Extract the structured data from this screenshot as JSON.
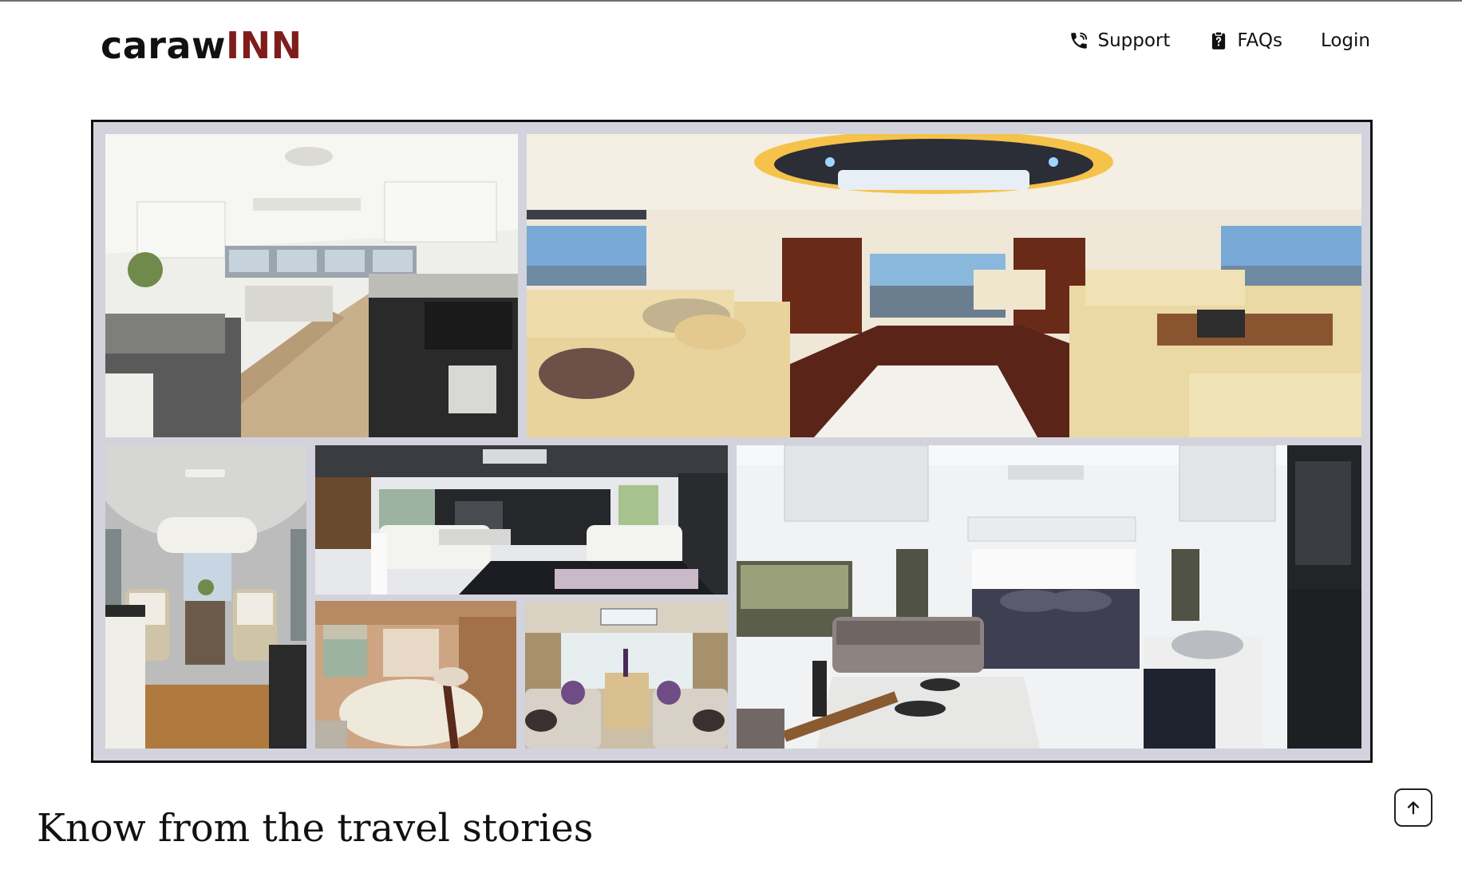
{
  "brand": {
    "name_part1": "caraw",
    "name_part2": "INN",
    "accent_color": "#7f1d1d"
  },
  "nav": {
    "items": [
      {
        "label": "Support",
        "icon": "phone-icon"
      },
      {
        "label": "FAQs",
        "icon": "clipboard-question-icon"
      },
      {
        "label": "Login"
      }
    ]
  },
  "gallery": {
    "tiles": [
      "caravan-interior-kitchen-lounge",
      "motorhome-luxury-lounge",
      "airstream-seating-nook",
      "caravan-dinette-kitchen",
      "caravan-bedroom-round-bed",
      "caravan-lounge-sofas",
      "caravan-bedroom-kitchen-dining"
    ]
  },
  "section": {
    "title": "Know from the travel stories"
  },
  "back_to_top": {
    "icon": "arrow-up-icon"
  }
}
